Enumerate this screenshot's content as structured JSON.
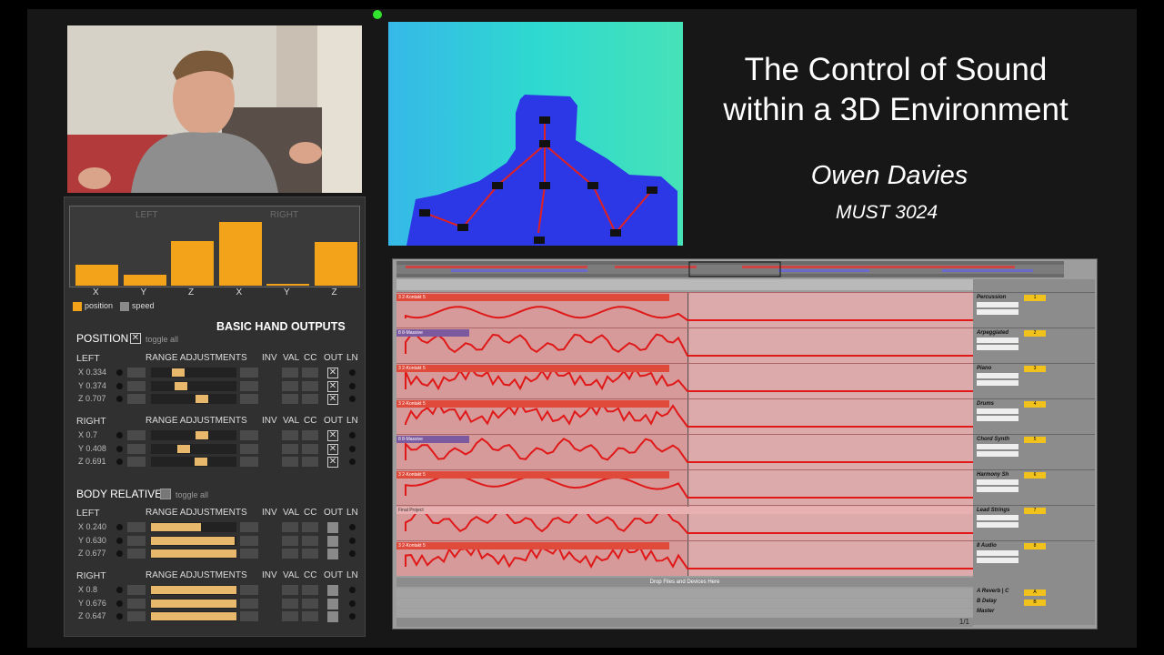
{
  "title": {
    "line1": "The Control of Sound",
    "line2": "within a 3D Environment"
  },
  "author": "Owen Davies",
  "course": "MUST 3024",
  "chart_data": {
    "type": "bar",
    "categories": [
      "X",
      "Y",
      "Z",
      "X",
      "Y",
      "Z"
    ],
    "groups": [
      "LEFT",
      "RIGHT"
    ],
    "series": [
      {
        "name": "position",
        "values": [
          0.334,
          0.174,
          0.707,
          1.0,
          0.02,
          0.691
        ]
      }
    ],
    "legend": [
      "position",
      "speed"
    ],
    "colors": {
      "position": "#f3a31a",
      "speed": "#8a8a8a"
    },
    "ylim": [
      0,
      1
    ]
  },
  "panel": {
    "heading": "BASIC HAND OUTPUTS",
    "position": {
      "title": "POSITION",
      "toggle": "toggle all",
      "left": {
        "label": "LEFT",
        "range": "RANGE ADJUSTMENTS",
        "inv": "INV",
        "val": "VAL",
        "cc": "CC",
        "out": "OUT",
        "ln": "LN",
        "rows": [
          {
            "axis": "X",
            "value": "0.334"
          },
          {
            "axis": "Y",
            "value": "0.374"
          },
          {
            "axis": "Z",
            "value": "0.707"
          }
        ]
      },
      "right": {
        "label": "RIGHT",
        "range": "RANGE ADJUSTMENTS",
        "inv": "INV",
        "val": "VAL",
        "cc": "CC",
        "out": "OUT",
        "ln": "LN",
        "rows": [
          {
            "axis": "X",
            "value": "0.7"
          },
          {
            "axis": "Y",
            "value": "0.408"
          },
          {
            "axis": "Z",
            "value": "0.691"
          }
        ]
      }
    },
    "body": {
      "title": "BODY RELATIVE",
      "toggle": "toggle all",
      "left": {
        "label": "LEFT",
        "range": "RANGE ADJUSTMENTS",
        "inv": "INV",
        "val": "VAL",
        "cc": "CC",
        "out": "OUT",
        "ln": "LN",
        "rows": [
          {
            "axis": "X",
            "value": "0.240"
          },
          {
            "axis": "Y",
            "value": "0.630"
          },
          {
            "axis": "Z",
            "value": "0.677"
          }
        ]
      },
      "right": {
        "label": "RIGHT",
        "range": "RANGE ADJUSTMENTS",
        "inv": "INV",
        "val": "VAL",
        "cc": "CC",
        "out": "OUT",
        "ln": "LN",
        "rows": [
          {
            "axis": "X",
            "value": "0.8"
          },
          {
            "axis": "Y",
            "value": "0.676"
          },
          {
            "axis": "Z",
            "value": "0.647"
          }
        ]
      }
    }
  },
  "daw": {
    "drop_text": "Drop Files and Devices Here",
    "page_indicator": "1/1",
    "tracks": [
      {
        "name": "Percussion",
        "num": "1"
      },
      {
        "name": "Arpeggiated",
        "num": "2"
      },
      {
        "name": "Piano",
        "num": "3"
      },
      {
        "name": "Drums",
        "num": "4"
      },
      {
        "name": "Chord Synth",
        "num": "5"
      },
      {
        "name": "Harmony Sh",
        "num": "6"
      },
      {
        "name": "Lead Strings",
        "num": "7"
      },
      {
        "name": "8 Audio",
        "num": "8"
      }
    ],
    "returns": [
      {
        "name": "A Reverb | C",
        "letter": "A"
      },
      {
        "name": "B Delay",
        "letter": "B"
      },
      {
        "name": "Master",
        "letter": ""
      }
    ],
    "clip_labels": {
      "kontakt": "3 2-Kontakt 5",
      "massive": "8 8-Massive",
      "final": "Final Project"
    }
  }
}
